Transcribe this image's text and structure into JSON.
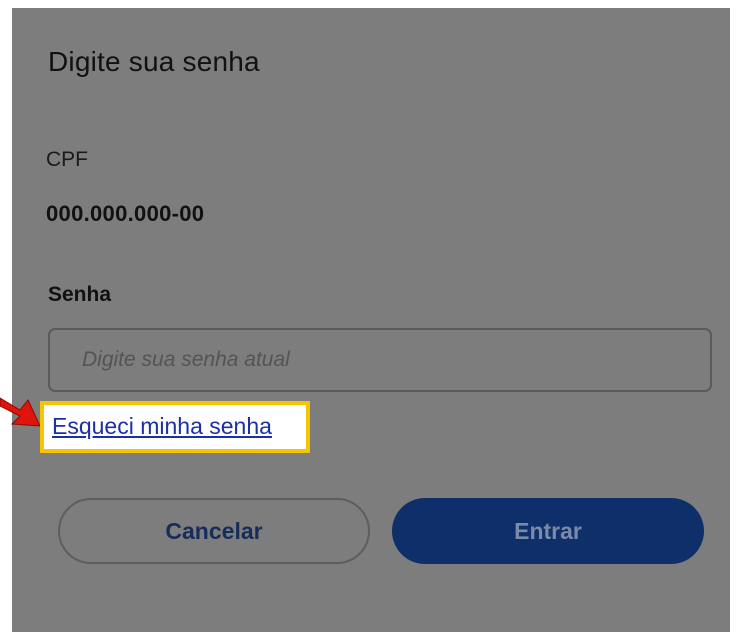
{
  "dialog": {
    "title": "Digite sua senha",
    "cpf_label": "CPF",
    "cpf_value": "000.000.000-00",
    "password_label": "Senha",
    "password_placeholder": "Digite sua senha atual",
    "password_value": "",
    "forgot_link": "Esqueci minha senha",
    "cancel_label": "Cancelar",
    "enter_label": "Entrar"
  },
  "annotation": {
    "highlight_color": "#f6c400",
    "arrow_color": "#e0140b",
    "arrow_icon": "arrow-right-icon"
  },
  "colors": {
    "overlay": "#7d7d7d",
    "primary": "#0f2f6b",
    "link": "#1a2fa8"
  }
}
